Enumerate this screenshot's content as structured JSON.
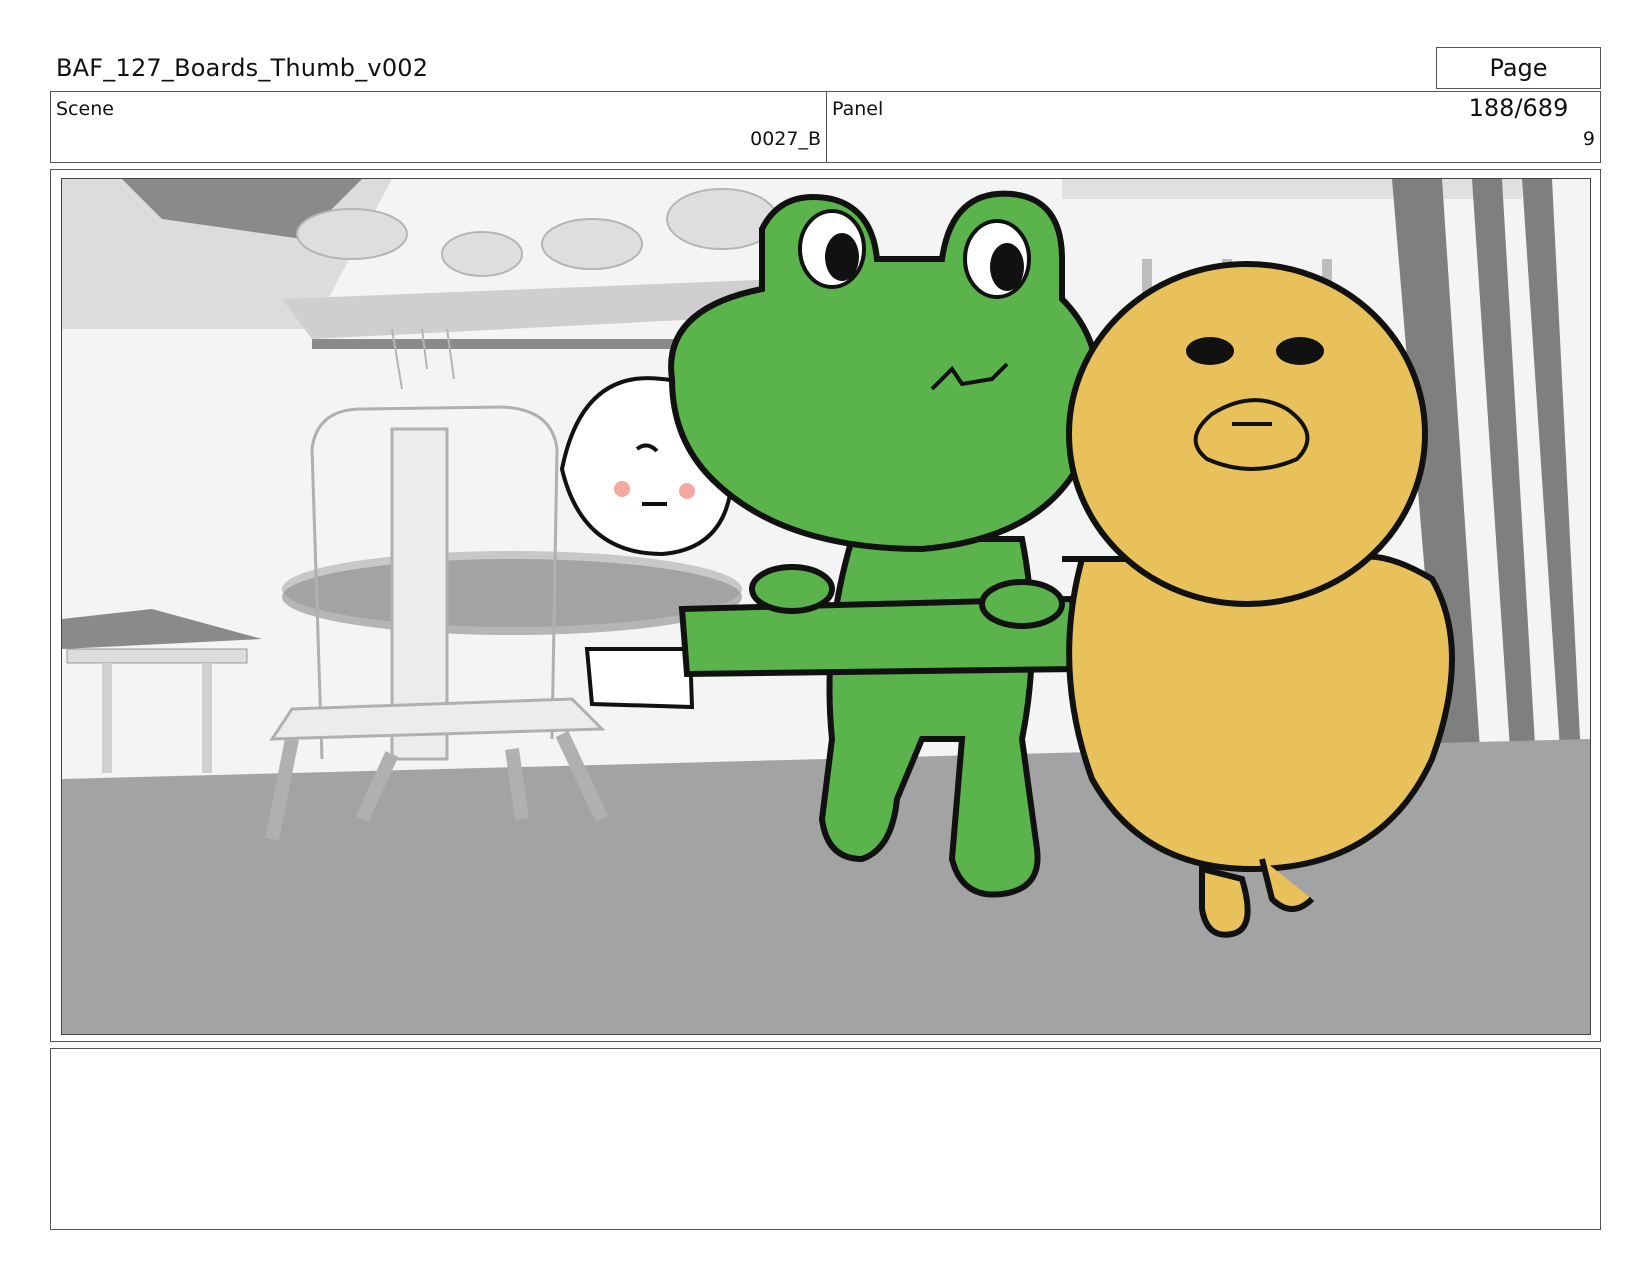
{
  "header": {
    "title": "BAF_127_Boards_Thumb_v002",
    "page": "Page 188/689"
  },
  "meta": {
    "scene_label": "Scene",
    "scene_value": "0027_B",
    "panel_label": "Panel",
    "panel_value": "9"
  },
  "notes": {
    "text": ""
  },
  "colors": {
    "frog_green": "#5bb34b",
    "duck_yellow": "#e8c15a",
    "floor_gray": "#a3a3a3",
    "wall_gray": "#7f7f7f"
  }
}
